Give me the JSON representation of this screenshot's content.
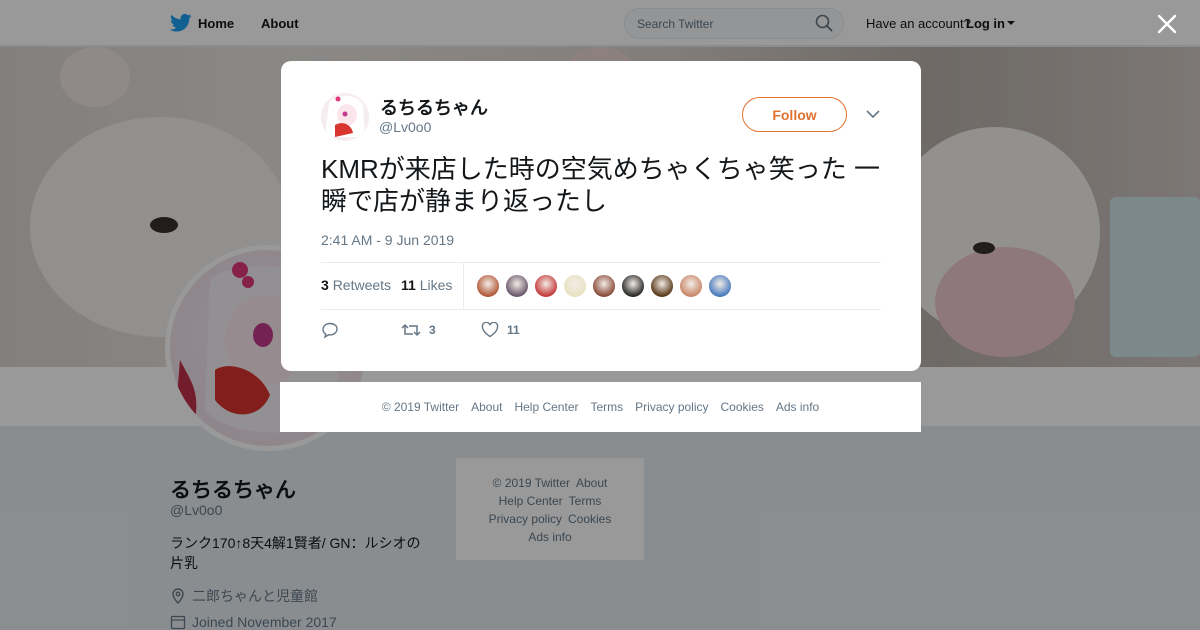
{
  "topbar": {
    "home_label": "Home",
    "about_label": "About",
    "search_placeholder": "Search Twitter",
    "have_account": "Have an account?",
    "login_label": "Log in"
  },
  "profile": {
    "name": "るちるちゃん",
    "handle": "@Lv0o0",
    "bio": "ランク170↑8天4解1賢者/ GN：ルシオの片乳",
    "location": "二郎ちゃんと児童館",
    "joined": "Joined November 2017"
  },
  "side_footer": [
    "© 2019 Twitter",
    "About",
    "Help Center",
    "Terms",
    "Privacy policy",
    "Cookies",
    "Ads info"
  ],
  "tweet": {
    "name": "るちるちゃん",
    "handle": "@Lv0o0",
    "follow_label": "Follow",
    "text": "KMRが来店した時の空気めちゃくちゃ笑った 一瞬で店が静まり返ったし",
    "time": "2:41 AM - 9 Jun 2019",
    "retweets_count": "3",
    "retweets_label": "Retweets",
    "likes_count": "11",
    "likes_label": "Likes",
    "reply_count": "",
    "retweet_action_count": "3",
    "like_action_count": "11",
    "likers": [
      "#b35a3a",
      "#6b5a6e",
      "#c43b3b",
      "#e8e2c2",
      "#8a4b3a",
      "#2b2b2b",
      "#5a3a1a",
      "#c9886a",
      "#4a7bbf"
    ]
  },
  "modal_footer": [
    "© 2019 Twitter",
    "About",
    "Help Center",
    "Terms",
    "Privacy policy",
    "Cookies",
    "Ads info"
  ],
  "colors": {
    "accent": "#e0712f",
    "twitter_blue": "#1da1f2",
    "muted": "#657786"
  }
}
